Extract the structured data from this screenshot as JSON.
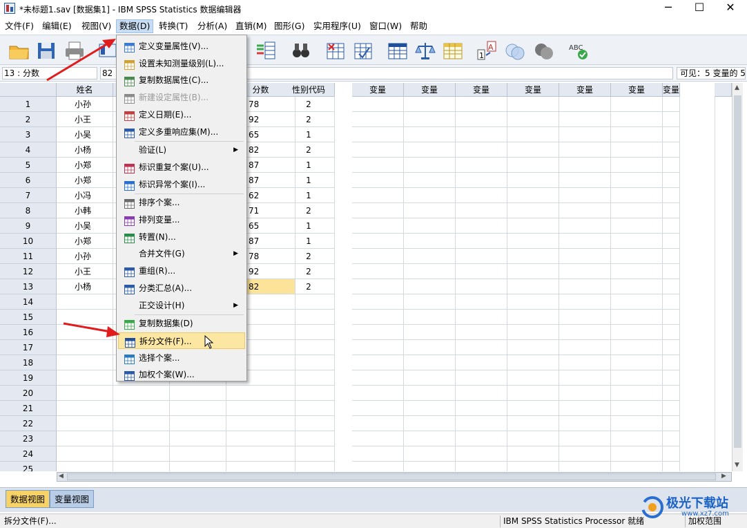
{
  "window": {
    "title": "*未标题1.sav [数据集1] - IBM SPSS Statistics 数据编辑器",
    "minimize": "─",
    "maximize": "☐",
    "close": "✕"
  },
  "menu": [
    "文件(F)",
    "编辑(E)",
    "视图(V)",
    "数据(D)",
    "转换(T)",
    "分析(A)",
    "直销(M)",
    "图形(G)",
    "实用程序(U)",
    "窗口(W)",
    "帮助"
  ],
  "cellbar": {
    "ref": "13 : 分数",
    "value": "82",
    "visible": "可见：5 变量的 5"
  },
  "columns": [
    "姓名",
    "",
    "",
    "分数",
    "性别代码",
    "变量",
    "变量",
    "变量",
    "变量",
    "变量",
    "变量",
    "变量"
  ],
  "rows": [
    {
      "n": "1",
      "name": "小孙",
      "score": "78",
      "gender": "2"
    },
    {
      "n": "2",
      "name": "小王",
      "score": "92",
      "gender": "2"
    },
    {
      "n": "3",
      "name": "小吴",
      "score": "65",
      "gender": "1"
    },
    {
      "n": "4",
      "name": "小杨",
      "score": "82",
      "gender": "2"
    },
    {
      "n": "5",
      "name": "小郑",
      "score": "87",
      "gender": "1"
    },
    {
      "n": "6",
      "name": "小郑",
      "score": "87",
      "gender": "1"
    },
    {
      "n": "7",
      "name": "小冯",
      "score": "62",
      "gender": "1"
    },
    {
      "n": "8",
      "name": "小韩",
      "score": "71",
      "gender": "2"
    },
    {
      "n": "9",
      "name": "小吴",
      "score": "65",
      "gender": "1"
    },
    {
      "n": "10",
      "name": "小郑",
      "score": "87",
      "gender": "1"
    },
    {
      "n": "11",
      "name": "小孙",
      "score": "78",
      "gender": "2"
    },
    {
      "n": "12",
      "name": "小王",
      "score": "92",
      "gender": "2"
    },
    {
      "n": "13",
      "name": "小杨",
      "score": "82",
      "gender": "2"
    },
    {
      "n": "14"
    },
    {
      "n": "15"
    },
    {
      "n": "16"
    },
    {
      "n": "17"
    },
    {
      "n": "18"
    },
    {
      "n": "19"
    },
    {
      "n": "20"
    },
    {
      "n": "21"
    },
    {
      "n": "22"
    },
    {
      "n": "23"
    },
    {
      "n": "24"
    },
    {
      "n": "25"
    }
  ],
  "dropdown": [
    {
      "label": "定义变量属性(V)...",
      "icon": "define-variable-properties-icon"
    },
    {
      "label": "设置未知测量级别(L)...",
      "icon": "set-measurement-level-icon"
    },
    {
      "label": "复制数据属性(C)...",
      "icon": "copy-data-properties-icon"
    },
    {
      "label": "新建设定属性(B)...",
      "icon": "new-custom-attribute-icon",
      "disabled": true
    },
    {
      "label": "定义日期(E)...",
      "icon": "define-dates-icon"
    },
    {
      "label": "定义多重响应集(M)...",
      "icon": "multiple-response-icon"
    },
    {
      "label": "验证(L)",
      "submenu": true
    },
    {
      "label": "标识重复个案(U)...",
      "icon": "identify-duplicates-icon"
    },
    {
      "label": "标识异常个案(I)...",
      "icon": "identify-unusual-icon"
    },
    {
      "label": "排序个案...",
      "icon": "sort-cases-icon"
    },
    {
      "label": "排列变量...",
      "icon": "sort-variables-icon"
    },
    {
      "label": "转置(N)...",
      "icon": "transpose-icon"
    },
    {
      "label": "合并文件(G)",
      "submenu": true
    },
    {
      "label": "重组(R)...",
      "icon": "restructure-icon"
    },
    {
      "label": "分类汇总(A)...",
      "icon": "aggregate-icon"
    },
    {
      "label": "正交设计(H)",
      "submenu": true
    },
    {
      "label": "复制数据集(D)",
      "icon": "copy-dataset-icon"
    },
    {
      "label": "拆分文件(F)...",
      "icon": "split-file-icon",
      "hover": true
    },
    {
      "label": "选择个案...",
      "icon": "select-cases-icon"
    },
    {
      "label": "加权个案(W)...",
      "icon": "weight-cases-icon"
    }
  ],
  "tabs": {
    "data_view": "数据视图",
    "variable_view": "变量视图"
  },
  "status": {
    "left": "拆分文件(F)...",
    "processor": "IBM SPSS Statistics Processor 就绪",
    "right": "加权范围"
  },
  "watermark": {
    "line1": "极光下载站",
    "line2": "www.xz7.com"
  },
  "colors": {
    "accent": "#fbe49a",
    "menu_hover": "#fbe6a2",
    "header": "#e4e9f1",
    "arrow": "#e01c1c"
  }
}
